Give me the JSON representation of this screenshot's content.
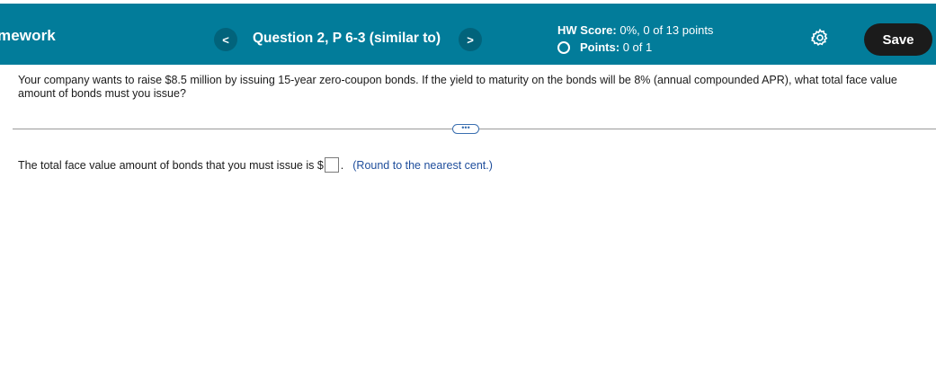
{
  "header": {
    "app_title": "mework",
    "prev_icon": "<",
    "next_icon": ">",
    "question_title": "Question 2, P 6-3 (similar to)",
    "hw_score_label": "HW Score:",
    "hw_score_value": "0%, 0 of 13 points",
    "points_label": "Points:",
    "points_value": "0 of 1",
    "settings_icon": "gear-icon",
    "save_label": "Save",
    "bar_color": "#027c9a"
  },
  "question": {
    "text": "Your company wants to raise $8.5 million by issuing 15-year zero-coupon bonds. If the yield to maturity on the bonds will be 8% (annual compounded APR), what total face value amount of bonds must you issue?",
    "more_label": "•••"
  },
  "answer": {
    "prefix": "The total face value amount of bonds that you must issue is $",
    "input_value": "",
    "suffix": ".",
    "hint": "(Round to the nearest cent.)"
  }
}
